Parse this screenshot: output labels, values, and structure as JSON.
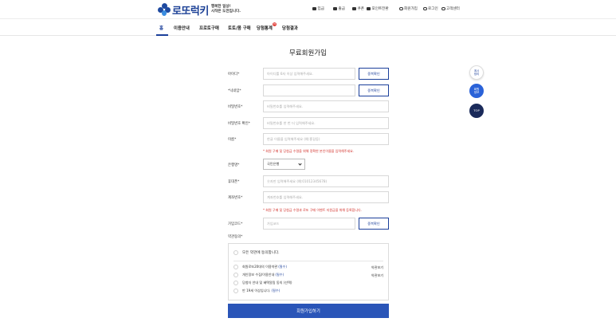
{
  "header": {
    "logo_text": "로또럭키",
    "tagline_line1": "행복한 일상!",
    "tagline_line2": "시작은 도전입니다.",
    "util_links": [
      "입금",
      "출금",
      "쿠폰",
      "포인트전환"
    ],
    "account_links": [
      "회원가입",
      "로그인",
      "고객센터"
    ]
  },
  "nav": {
    "items": [
      "홈",
      "이용안내",
      "프로토구매",
      "토토/몸 구매",
      "당첨통계",
      "당첨결과"
    ],
    "badge": "N"
  },
  "page_title": "무료회원가입",
  "form": {
    "user_id": {
      "label": "아이디*",
      "placeholder": "아이디를 6자 이상 입력해주세요.",
      "button": "중복확인"
    },
    "nickname": {
      "label": "*닉네임*",
      "placeholder": "",
      "button": "중복확인"
    },
    "password": {
      "label": "비밀번호*",
      "placeholder": "비밀번호를 입력해주세요."
    },
    "password_confirm": {
      "label": "비밀번호 확인*",
      "placeholder": "비밀번호를 한 번 더 입력해주세요."
    },
    "name": {
      "label": "이름*",
      "placeholder": "한글 이름을 입력해주세요 (예:홍길동)"
    },
    "name_notice": "* 회원 구매 및 당첨금 수령을 위해 정확한 본인이름을 입력해주세요.",
    "bank": {
      "label": "은행명*",
      "selected": "국민은행"
    },
    "phone": {
      "label": "휴대폰*",
      "placeholder": "숫자만 입력해주세요 (예:01012345678)"
    },
    "account": {
      "label": "계좌번호*",
      "placeholder": "계좌번호를 입력해주세요."
    },
    "account_notice": "* 회원 구매 및 당첨금 수령과 로또 구매 이벤트 지원금을 위해 등록합니다.",
    "join_code": {
      "label": "가입코드*",
      "placeholder": "가입코드",
      "button": "중복확인"
    },
    "terms_label": "약관동의*"
  },
  "terms": {
    "all": "모든 약관에 동의합니다.",
    "items": [
      {
        "text": "회원로또20대의 이용약관",
        "req": "(필수)",
        "view": "약관보기"
      },
      {
        "text": "개인정보 수집/이용안내",
        "req": "(필수)",
        "view": "약관보기"
      },
      {
        "text": "당첨자 안내 및 혜택알림 동의 (선택)",
        "req": "",
        "view": ""
      },
      {
        "text": "만 19세 이상입니다.",
        "req": "(필수)",
        "view": ""
      }
    ]
  },
  "submit_label": "회원가입하기",
  "float_buttons": {
    "f1_line1": "계시",
    "f1_line2": "정리",
    "f2_line1": "회원",
    "f2_line2": "정보",
    "f3": "TOP"
  }
}
